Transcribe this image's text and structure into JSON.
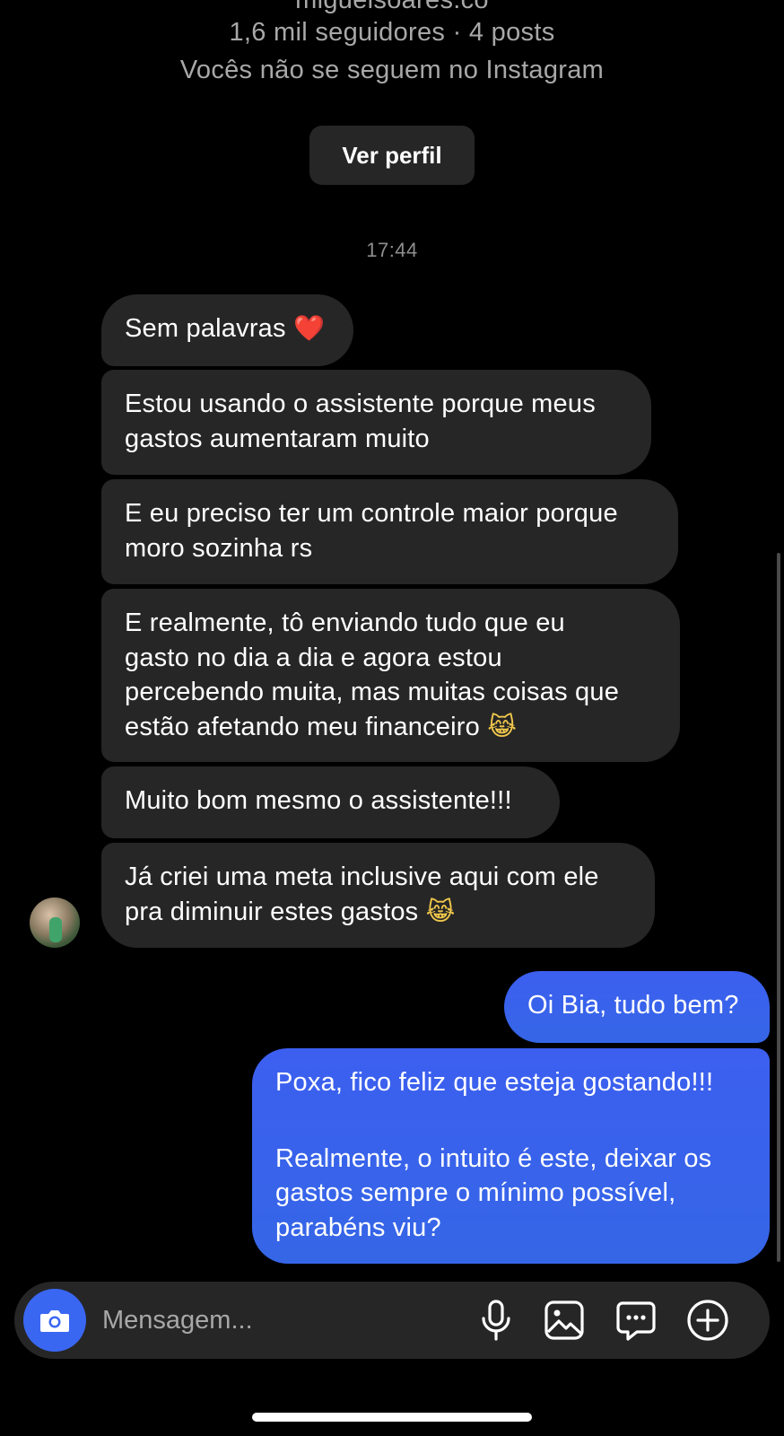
{
  "profile": {
    "handle": "miguelsoares.co",
    "stats": "1,6 mil seguidores · 4 posts",
    "follow_status": "Vocês não se seguem no Instagram",
    "view_profile_label": "Ver perfil"
  },
  "conversation": {
    "timestamp": "17:44",
    "incoming": [
      {
        "text": "Sem palavras",
        "emoji": "❤️"
      },
      {
        "line1": "Estou usando o assistente porque meus",
        "line2": "gastos aumentaram muito"
      },
      {
        "line1": "E eu preciso ter um controle maior porque",
        "line2": "moro sozinha rs"
      },
      {
        "line1": "E realmente, tô enviando tudo que eu",
        "line2": "gasto no dia a dia e agora estou",
        "line3": "percebendo muita, mas muitas coisas que",
        "line4": "estão afetando meu financeiro",
        "emoji": "😹"
      },
      {
        "text": "Muito bom mesmo o assistente!!!"
      },
      {
        "line1": "Já criei uma meta inclusive aqui com ele",
        "line2": "pra diminuir estes gastos",
        "emoji": "😹"
      }
    ],
    "outgoing": [
      {
        "text": "Oi Bia, tudo bem?"
      },
      {
        "line1": "Poxa, fico feliz que esteja gostando!!!",
        "line2": "Realmente, o intuito é este, deixar os",
        "line3": "gastos sempre o mínimo possível,",
        "line4": "parabéns viu?"
      }
    ]
  },
  "composer": {
    "placeholder": "Mensagem...",
    "icons": [
      "camera-icon",
      "microphone-icon",
      "gallery-icon",
      "sticker-icon",
      "plus-icon"
    ]
  },
  "colors": {
    "background": "#000000",
    "incoming_bubble": "#262626",
    "outgoing_bubble": "#3c5ff0",
    "camera_button": "#3a67f2",
    "secondary_text": "#a8a8a8"
  }
}
